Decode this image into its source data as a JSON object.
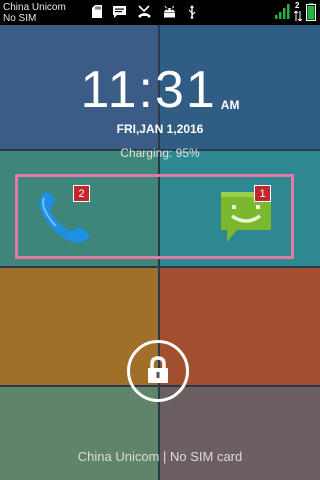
{
  "status_bar": {
    "carrier": "China Unicom",
    "sim_status": "No SIM",
    "icons": [
      "sd-card-icon",
      "message-icon",
      "missed-call-icon",
      "android-icon",
      "usb-icon",
      "signal-icon",
      "data-icon",
      "battery-icon"
    ],
    "data_indicator": "2"
  },
  "lockscreen": {
    "time": "11:31",
    "ampm": "AM",
    "date": "FRI,JAN 1,2016",
    "charging": "Charging: 95%",
    "shortcuts": [
      {
        "name": "phone",
        "badge": "2"
      },
      {
        "name": "messages",
        "badge": "1"
      }
    ],
    "bottom_text": "China Unicom  |  No SIM card"
  },
  "colors": {
    "tile_top_left": "#3b5c86",
    "tile_top_right": "#2f5d84",
    "tile_mid_left": "#3e8679",
    "tile_mid_right": "#2e8891",
    "tile_low_left": "#a06f2a",
    "tile_low_right": "#a24f2f",
    "tile_bottom_left": "#5f8469",
    "tile_bottom_right": "#6c5f62",
    "highlight": "#e27aa6",
    "badge": "#c1272d"
  }
}
